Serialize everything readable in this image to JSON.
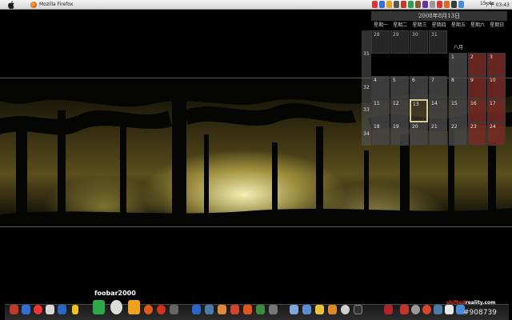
{
  "top_panel": {
    "taskbar_window_title": "Mozilla Firefox",
    "tray_labels": [
      "15",
      "4x"
    ],
    "clock": "下午 03:43"
  },
  "calendar": {
    "date_title": "2008年8月13日",
    "weekday_headers": [
      "星期一",
      "星期二",
      "星期三",
      "星期四",
      "星期五",
      "星期六",
      "星期日"
    ],
    "month_label": "八月",
    "week_numbers": [
      "31",
      "32",
      "33",
      "34"
    ],
    "prev_month_days": [
      "28",
      "29",
      "30",
      "31"
    ],
    "days": [
      "1",
      "2",
      "3",
      "4",
      "5",
      "6",
      "7",
      "8",
      "9",
      "10",
      "11",
      "12",
      "13",
      "14",
      "15",
      "16",
      "17",
      "18",
      "19",
      "20",
      "21",
      "22",
      "23",
      "24"
    ],
    "today": "13"
  },
  "dock": {
    "hover_label": "foobar2000",
    "brand_text_prefix": "shifted",
    "brand_text_suffix": "reality.com",
    "watermark": "#908739"
  },
  "colors": {
    "weekend_cell": "#782c26",
    "weekday_cell": "#464646",
    "today_border": "#d8c89a"
  }
}
